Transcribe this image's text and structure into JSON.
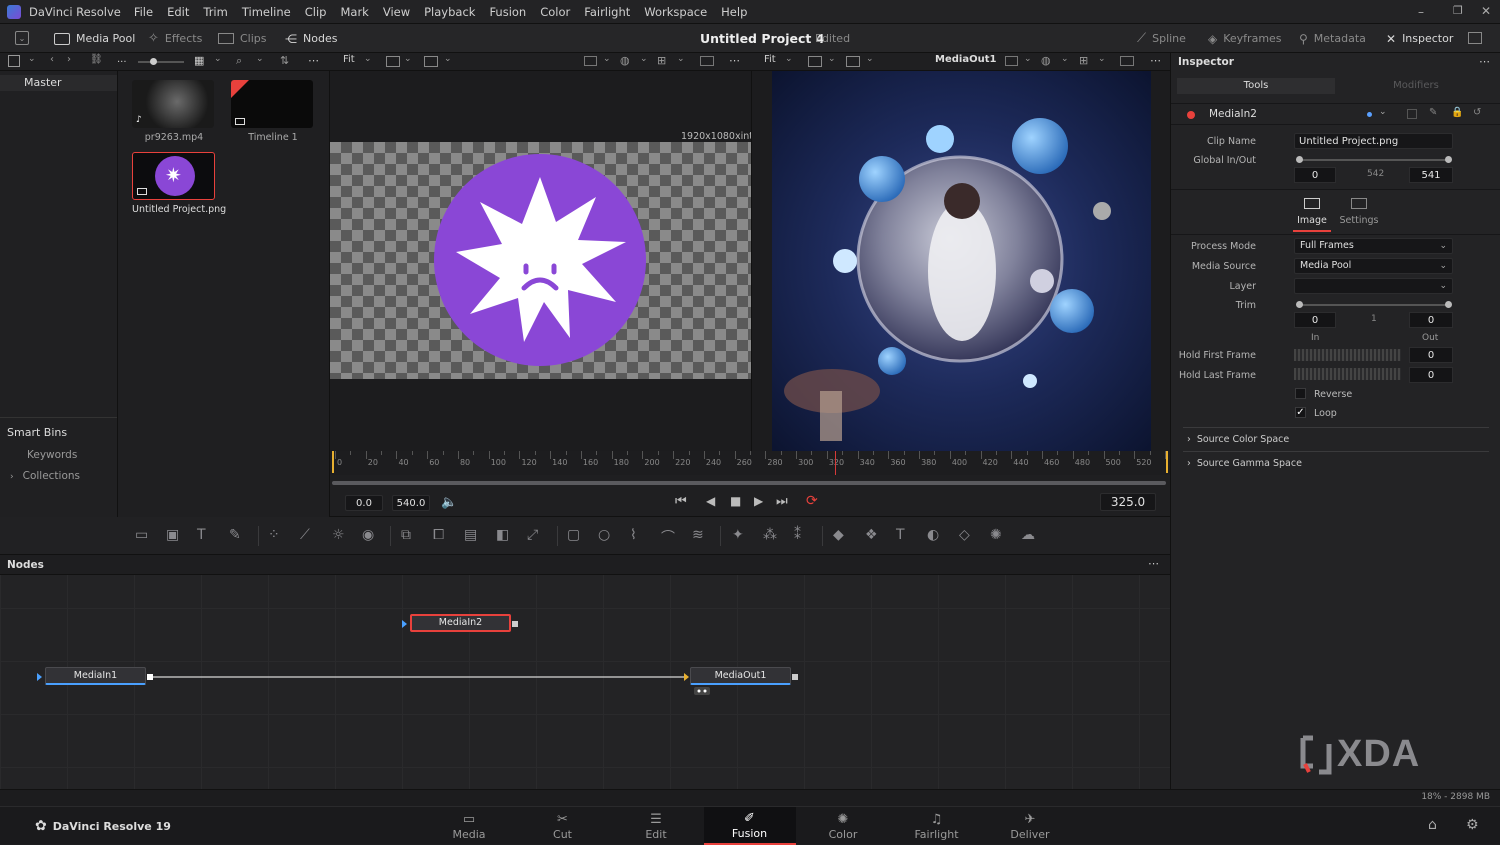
{
  "app": {
    "name": "DaVinci Resolve",
    "footer_name": "DaVinci Resolve 19"
  },
  "menu": [
    "File",
    "Edit",
    "Trim",
    "Timeline",
    "Clip",
    "Mark",
    "View",
    "Playback",
    "Fusion",
    "Color",
    "Fairlight",
    "Workspace",
    "Help"
  ],
  "toolbar": {
    "media_pool": "Media Pool",
    "effects": "Effects",
    "clips": "Clips",
    "nodes": "Nodes",
    "project_title": "Untitled Project 4",
    "project_status": "Edited",
    "spline": "Spline",
    "keyframes": "Keyframes",
    "metadata": "Metadata",
    "inspector": "Inspector"
  },
  "subbar": {
    "ellipsis": "...",
    "fit1": "Fit",
    "fit2": "Fit",
    "viewer2_title": "MediaOut1"
  },
  "mediapool": {
    "bin_master": "Master",
    "smart_bins": "Smart Bins",
    "keywords": "Keywords",
    "collections": "Collections",
    "clips": [
      {
        "name": "pr9263.mp4"
      },
      {
        "name": "Timeline 1"
      },
      {
        "name": "Untitled Project.png"
      }
    ]
  },
  "viewer1": {
    "resolution": "1920x1080xint8"
  },
  "ruler": {
    "ticks": [
      "0",
      "20",
      "40",
      "60",
      "80",
      "100",
      "120",
      "140",
      "160",
      "180",
      "200",
      "220",
      "240",
      "260",
      "280",
      "300",
      "320",
      "340",
      "360",
      "380",
      "400",
      "420",
      "440",
      "460",
      "480",
      "500",
      "520"
    ],
    "playhead": 325
  },
  "transport": {
    "start": "0.0",
    "end": "540.0",
    "current": "325.0"
  },
  "nodes_panel": {
    "title": "Nodes",
    "node1": "MediaIn1",
    "node2": "MediaIn2",
    "node3": "MediaOut1"
  },
  "inspector": {
    "title": "Inspector",
    "tab_tools": "Tools",
    "tab_modifiers": "Modifiers",
    "node_name": "MediaIn2",
    "clip_name_label": "Clip Name",
    "clip_name": "Untitled Project.png",
    "global_inout_label": "Global In/Out",
    "global_in": "0",
    "global_mid": "542",
    "global_out": "541",
    "subtab_image": "Image",
    "subtab_settings": "Settings",
    "process_mode_label": "Process Mode",
    "process_mode": "Full Frames",
    "media_source_label": "Media Source",
    "media_source": "Media Pool",
    "layer_label": "Layer",
    "layer": "",
    "trim_label": "Trim",
    "trim_in": "0",
    "trim_mid": "1",
    "trim_out": "0",
    "in_label": "In",
    "out_label": "Out",
    "hold_first_label": "Hold First Frame",
    "hold_first": "0",
    "hold_last_label": "Hold Last Frame",
    "hold_last": "0",
    "reverse_label": "Reverse",
    "reverse": false,
    "loop_label": "Loop",
    "loop": true,
    "source_color_space": "Source Color Space",
    "source_gamma_space": "Source Gamma Space"
  },
  "status": {
    "memory": "18% - 2898 MB"
  },
  "pages": [
    {
      "label": "Media",
      "icon": "media-page-icon"
    },
    {
      "label": "Cut",
      "icon": "cut-page-icon"
    },
    {
      "label": "Edit",
      "icon": "edit-page-icon"
    },
    {
      "label": "Fusion",
      "icon": "fusion-page-icon",
      "active": true
    },
    {
      "label": "Color",
      "icon": "color-page-icon"
    },
    {
      "label": "Fairlight",
      "icon": "fairlight-page-icon"
    },
    {
      "label": "Deliver",
      "icon": "deliver-page-icon"
    }
  ],
  "watermark": "XDA",
  "colors": {
    "accent_red": "#e8413c",
    "purple": "#8a47d6",
    "playhead": "#d63a3a"
  }
}
